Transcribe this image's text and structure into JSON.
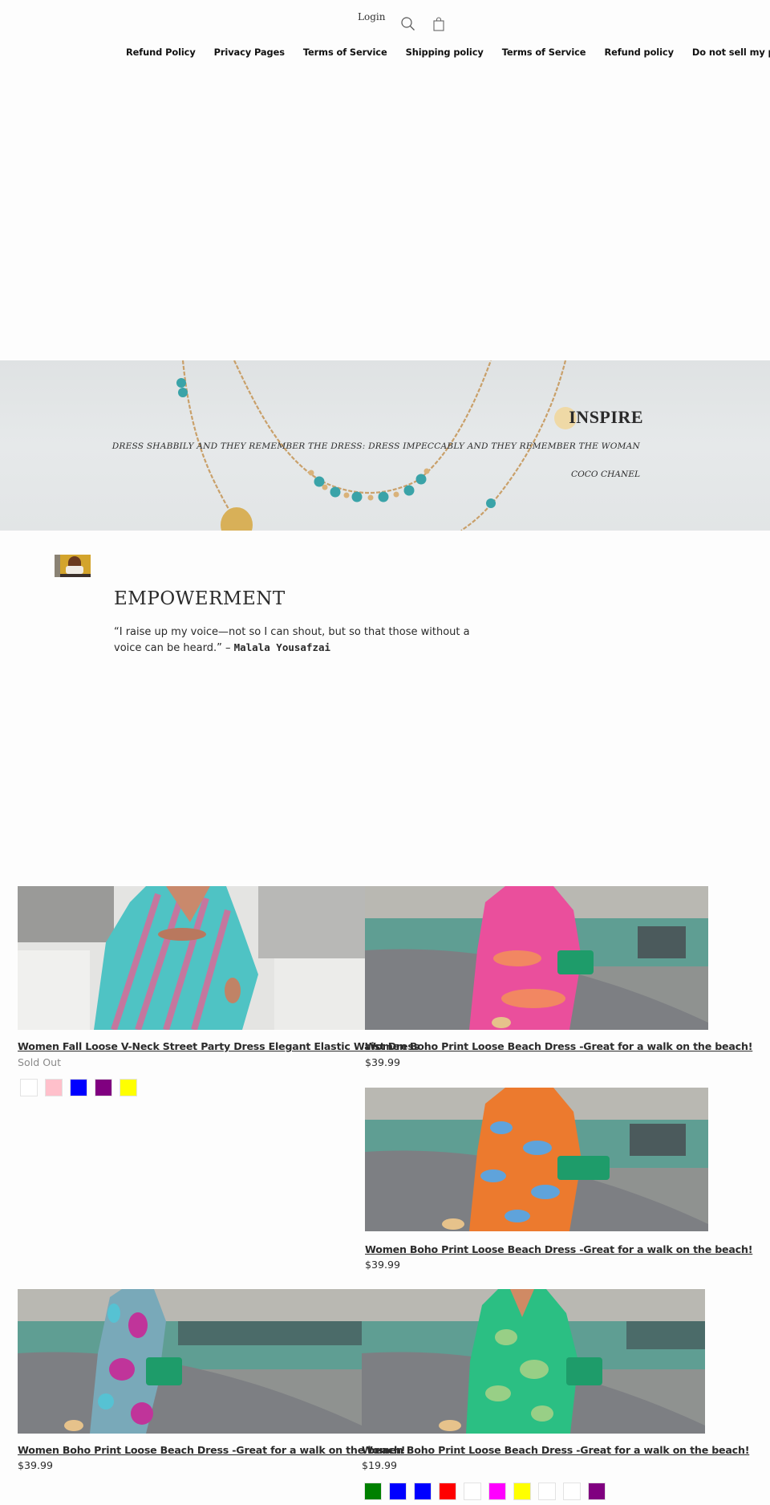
{
  "header": {
    "login_label": "Login",
    "search_icon": "search-icon",
    "cart_icon": "shopping-bag-icon"
  },
  "nav": {
    "items": [
      {
        "label": "Refund Policy"
      },
      {
        "label": "Privacy Pages"
      },
      {
        "label": "Terms of Service"
      },
      {
        "label": "Shipping policy"
      },
      {
        "label": "Terms of Service"
      },
      {
        "label": "Refund policy"
      },
      {
        "label": "Do not sell my personal info"
      }
    ]
  },
  "banner": {
    "title": "INSPIRE",
    "quote": "DRESS SHABBILY AND THEY REMEMBER THE DRESS: DRESS IMPECCABLY AND THEY REMEMBER THE WOMAN",
    "author": "COCO CHANEL",
    "image_alt": "Gold necklace with turquoise beads"
  },
  "empowerment": {
    "thumbnail_alt": "Woman on yellow background",
    "title": "EMPOWERMENT",
    "quote": "“I raise up my voice—not so I can shout, but so that those without a voice can be heard.” – ",
    "author": "Malala Yousafzai"
  },
  "products": [
    {
      "title": "Women Fall Loose V-Neck Street Party Dress Elegant Elastic Waist Dress",
      "price": "Sold Out",
      "sold_out": true,
      "image_alt": "Turquoise and pink striped v-neck dress",
      "swatches": [
        "#ffffff",
        "#ffc0cb",
        "#0000ff",
        "#800080",
        "#ffff00"
      ]
    },
    {
      "title": "Women Boho Print Loose Beach Dress -Great for a walk on the beach!",
      "price": "$39.99",
      "sold_out": false,
      "image_alt": "Pink boho print beach dress",
      "swatches": []
    },
    {
      "title": "Women Boho Print Loose Beach Dress -Great for a walk on the beach!",
      "price": "$39.99",
      "sold_out": false,
      "image_alt": "Orange and blue boho print beach dress",
      "swatches": []
    },
    {
      "title": "Women Boho Print Loose Beach Dress -Great for a walk on the beach!",
      "price": "$39.99",
      "sold_out": false,
      "image_alt": "Blue and magenta boho print beach dress",
      "swatches": []
    },
    {
      "title": "Women Boho Print Loose Beach Dress -Great for a walk on the beach!",
      "price": "$19.99",
      "sold_out": false,
      "image_alt": "Green boho print beach dress",
      "swatches": [
        "#008000",
        "#0000ff",
        "#0000ff",
        "#ff0000",
        "#ffffff",
        "#ff00ff",
        "#ffff00",
        "#ffffff",
        "#ffffff",
        "#800080"
      ]
    }
  ]
}
